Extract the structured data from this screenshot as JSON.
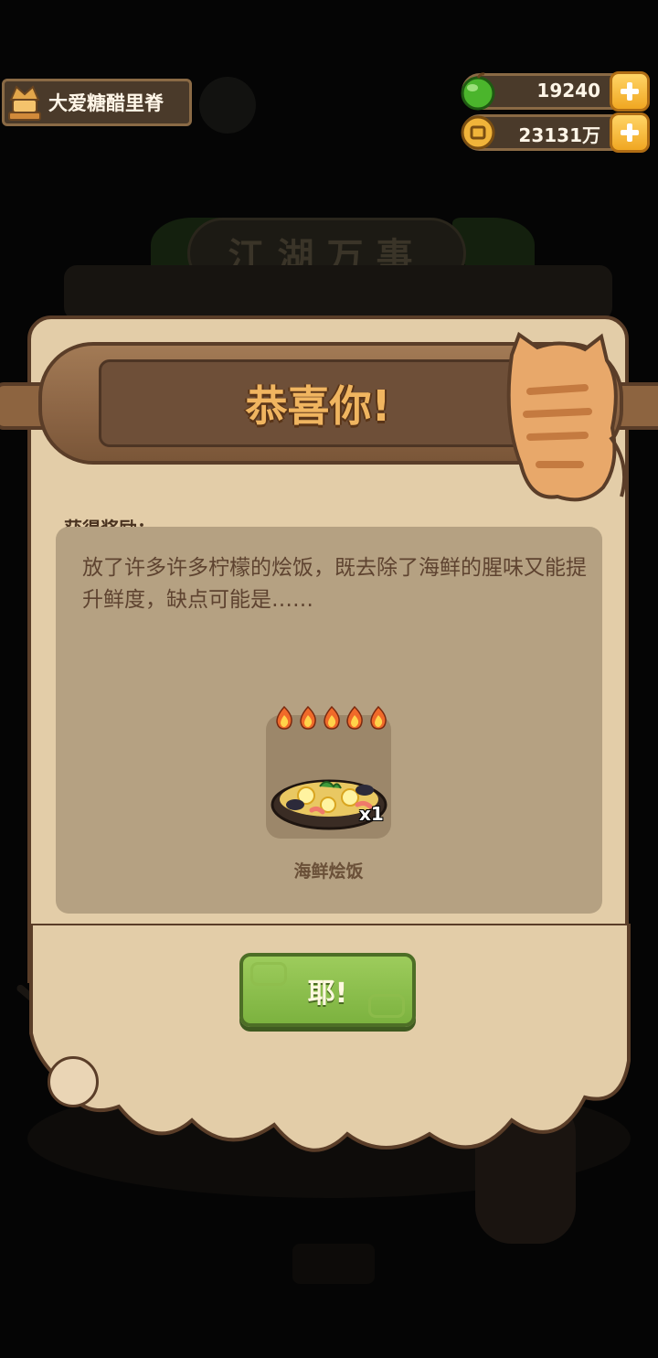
{
  "player": {
    "name": "大爱糖醋里脊"
  },
  "currencies": {
    "gems": {
      "value": "19240",
      "color": "#4bb52c"
    },
    "coins": {
      "value": "23131万",
      "color": "#f0b43a"
    }
  },
  "background": {
    "title": "江湖万事"
  },
  "dialog": {
    "title": "恭喜你!",
    "reward_label": "获得奖励：",
    "description": "放了许多许多柠檬的烩饭，既去除了海鲜的腥味又能提升鲜度，缺点可能是……",
    "item": {
      "name": "海鲜烩饭",
      "quantity": "x1",
      "stars": 5
    },
    "confirm_label": "耶!"
  }
}
